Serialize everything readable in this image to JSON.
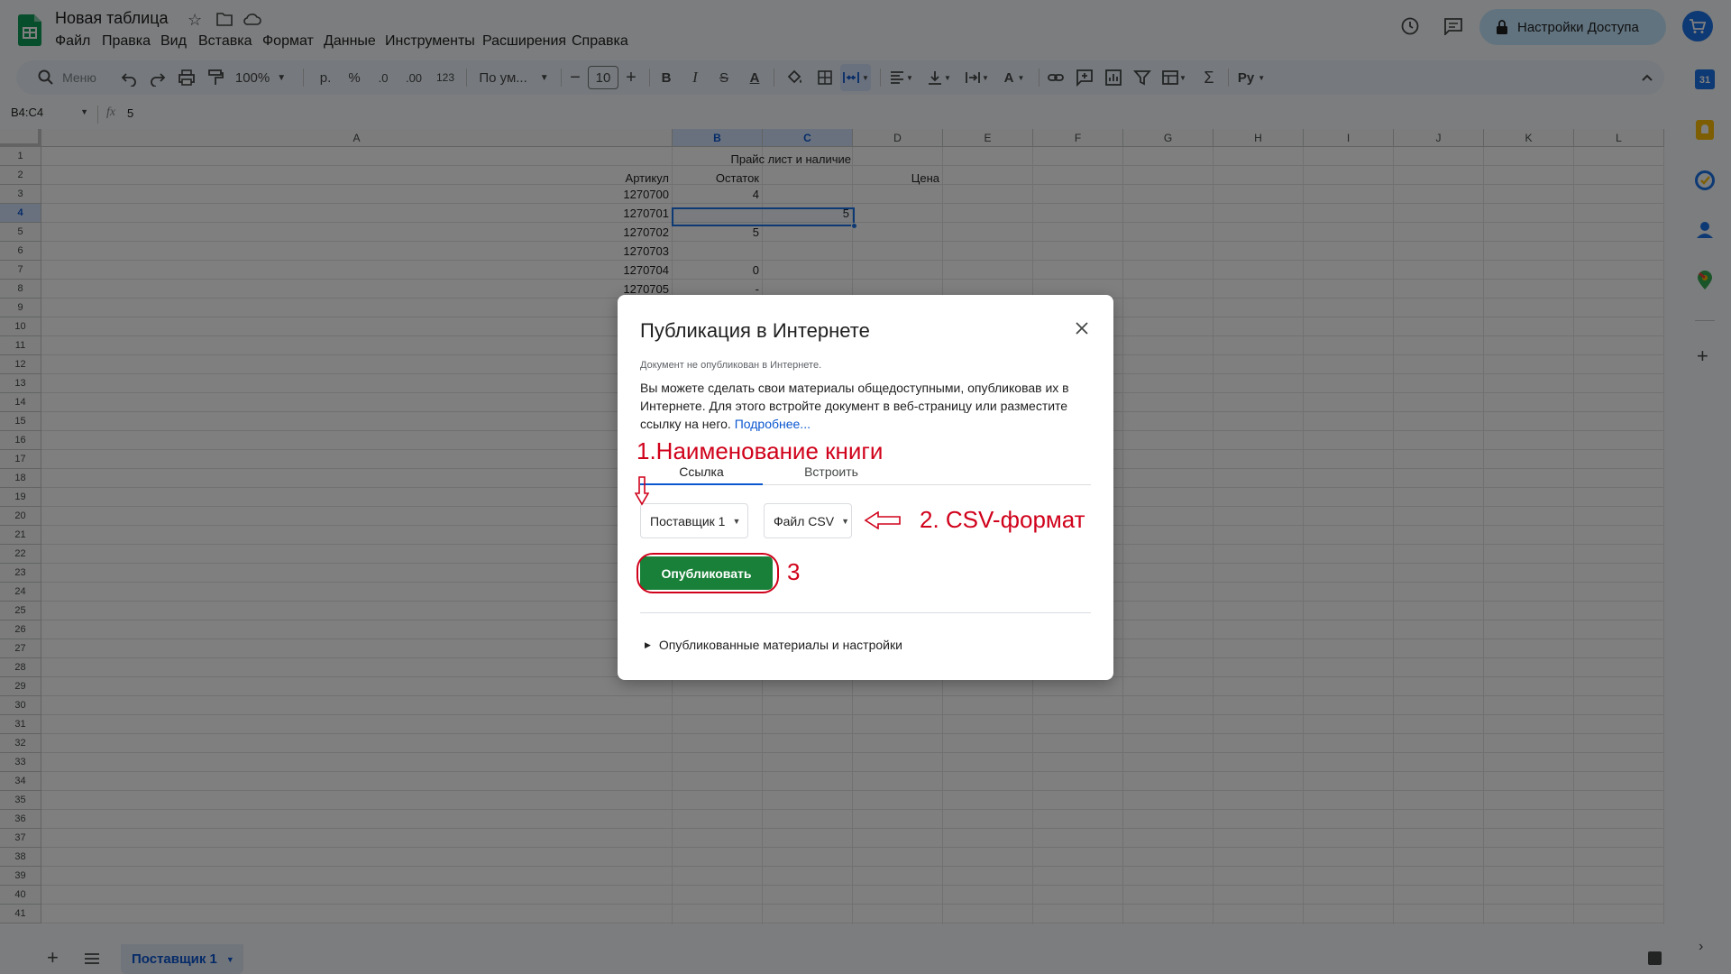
{
  "app": {
    "doc_title": "Новая таблица",
    "menu": [
      "Файл",
      "Правка",
      "Вид",
      "Вставка",
      "Формат",
      "Данные",
      "Инструменты",
      "Расширения",
      "Справка"
    ],
    "share_label": "Настройки Доступа"
  },
  "toolbar": {
    "search_placeholder": "Меню",
    "zoom": "100%",
    "currency": "р.",
    "percent": "%",
    "dec_decrease": ".0",
    "dec_increase": ".00",
    "num_format": "123",
    "font": "По ум...",
    "font_size": "10",
    "bold": "B",
    "italic": "I",
    "strike": "S",
    "text_color": "A"
  },
  "formula_bar": {
    "name_box": "B4:C4",
    "fx": "fx",
    "value": "5"
  },
  "grid": {
    "columns": [
      "A",
      "B",
      "C",
      "D",
      "E",
      "F",
      "G",
      "H",
      "I",
      "J",
      "K",
      "L"
    ],
    "selected_columns": [
      "B",
      "C"
    ],
    "selected_row": 4,
    "row_count": 41,
    "cells": {
      "title": "Прайс лист и наличие",
      "header_article": "Артикул",
      "header_stock": "Остаток",
      "header_price": "Цена",
      "rows": [
        {
          "article": "1270700",
          "stock": "4",
          "c": ""
        },
        {
          "article": "1270701",
          "stock": "",
          "c": "5"
        },
        {
          "article": "1270702",
          "stock": "5",
          "c": ""
        },
        {
          "article": "1270703",
          "stock": "",
          "c": ""
        },
        {
          "article": "1270704",
          "stock": "0",
          "c": ""
        },
        {
          "article": "1270705",
          "stock": "-",
          "c": ""
        }
      ]
    }
  },
  "sheet_tab": "Поставщик 1",
  "dialog": {
    "title": "Публикация в Интернете",
    "status": "Документ не опубликован в Интернете.",
    "description": "Вы можете сделать свои материалы общедоступными, опубликовав их в Интернете. Для этого встройте документ в веб-страницу или разместите ссылку на него.",
    "more_link": "Подробнее...",
    "tabs": [
      "Ссылка",
      "Встроить"
    ],
    "sheet_select": "Поставщик 1",
    "format_select": "Файл CSV",
    "publish_button": "Опубликовать",
    "published_section": "Опубликованные материалы и настройки"
  },
  "annotations": {
    "a1": "1.Наименование книги",
    "a2": "2. CSV-формат",
    "a3": "3"
  },
  "colors": {
    "accent": "#0b57d0",
    "publish_green": "#188038",
    "annotation_red": "#d0021b",
    "sheets_green": "#0f9d58"
  },
  "side_icons": [
    "calendar-icon",
    "keep-icon",
    "tasks-icon",
    "contacts-icon",
    "maps-icon",
    "add-icon"
  ]
}
